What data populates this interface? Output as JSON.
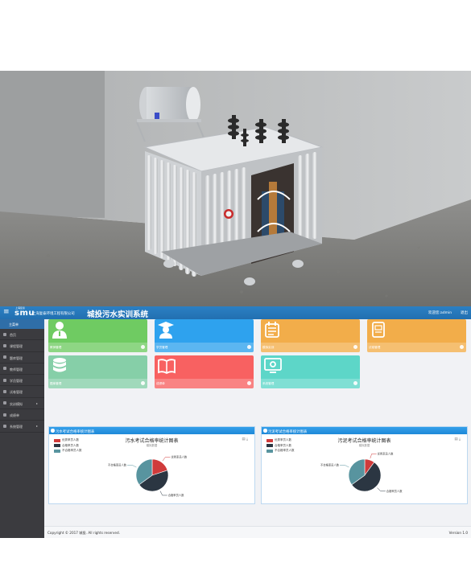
{
  "header": {
    "menu_glyph": "≡",
    "logo_small_text": "上海复泰",
    "logo_mark": "smu",
    "logo_company": "上海复泰环境工程有限公司",
    "app_title": "城投污水实训系统",
    "welcome": "欢迎您:admin",
    "logout": "退出"
  },
  "sidebar": {
    "home_tab": "主菜单",
    "items": [
      {
        "label": "首页",
        "has_arrow": false
      },
      {
        "label": "课程管理",
        "has_arrow": false
      },
      {
        "label": "题库管理",
        "has_arrow": false
      },
      {
        "label": "教师管理",
        "has_arrow": false
      },
      {
        "label": "学员管理",
        "has_arrow": false
      },
      {
        "label": "试卷管理",
        "has_arrow": false
      },
      {
        "label": "实训模拟",
        "has_arrow": true
      },
      {
        "label": "成绩单",
        "has_arrow": false
      },
      {
        "label": "系统管理",
        "has_arrow": true
      }
    ]
  },
  "tiles": [
    {
      "label": "教师管理",
      "color": "#6fcb62",
      "icon": "teacher-icon"
    },
    {
      "label": "学员管理",
      "color": "#2ea2ee",
      "icon": "graduate-icon"
    },
    {
      "label": "模拟实训",
      "color": "#f2ad4a",
      "icon": "calendar-icon"
    },
    {
      "label": "试卷管理",
      "color": "#f2ad4a",
      "icon": "exam-paper-icon"
    },
    {
      "label": "题库管理",
      "color": "#86cfa8",
      "icon": "database-icon"
    },
    {
      "label": "成绩单",
      "color": "#f86161",
      "icon": "book-icon"
    },
    {
      "label": "系统管理",
      "color": "#5dd6c8",
      "icon": "monitor-gear-icon"
    }
  ],
  "panels": [
    {
      "header": "污水考试合格率统计图表",
      "chart_title": "污水考试合格率统计图表",
      "subtitle": "模拟数据",
      "tools": "▤ ⤓"
    },
    {
      "header": "污泥考试合格率统计图表",
      "chart_title": "污泥考试合格率统计图表",
      "subtitle": "模拟数据",
      "tools": "▤ ⤓"
    }
  ],
  "chart_data": [
    {
      "type": "pie",
      "title": "污水考试合格率统计图表",
      "subtitle": "模拟数据",
      "legend_position": "top-left",
      "slices": [
        {
          "name": "优秀率员人数",
          "value": 20,
          "color": "#d03b3b"
        },
        {
          "name": "合格率员人数",
          "value": 45,
          "color": "#2b3642"
        },
        {
          "name": "不合格率员人数",
          "value": 35,
          "color": "#58949f"
        }
      ],
      "labels": [
        "优秀率员人数",
        "合格率员人数",
        "不合格率员人数"
      ]
    },
    {
      "type": "pie",
      "title": "污泥考试合格率统计图表",
      "subtitle": "模拟数据",
      "legend_position": "top-left",
      "slices": [
        {
          "name": "优秀率员人数",
          "value": 10,
          "color": "#d03b3b"
        },
        {
          "name": "合格率员人数",
          "value": 55,
          "color": "#2b3642"
        },
        {
          "name": "不合格率员人数",
          "value": 35,
          "color": "#58949f"
        }
      ],
      "labels": [
        "优秀率员人数",
        "合格率员人数",
        "不合格率员人数"
      ]
    }
  ],
  "footer": {
    "copyright": "Copyright © 2017 城投. All rights reserved.",
    "version": "Version 1.0"
  }
}
